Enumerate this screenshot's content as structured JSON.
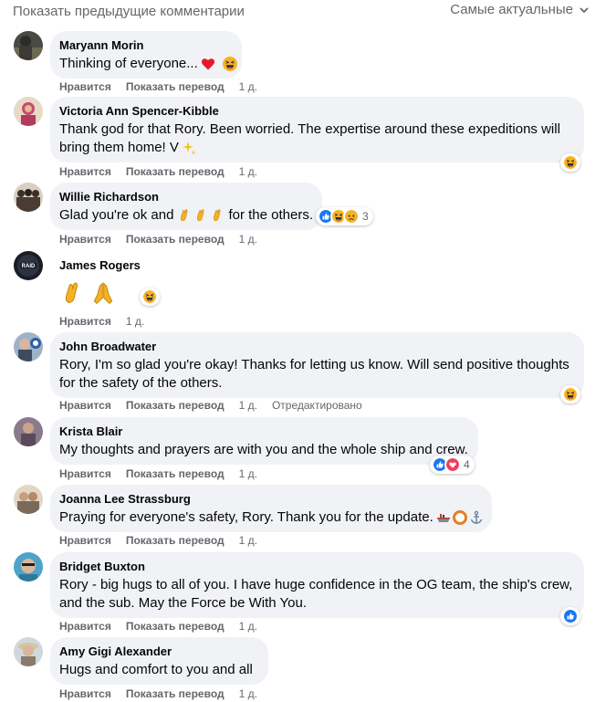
{
  "header": {
    "prev_comments": "Показать предыдущие комментарии",
    "sort_label": "Самые актуальные"
  },
  "actions": {
    "like": "Нравится",
    "translate": "Показать перевод",
    "edited": "Отредактировано"
  },
  "comments": [
    {
      "author": "Maryann Morin",
      "text": "Thinking of everyone...",
      "time": "1 д."
    },
    {
      "author": "Victoria Ann Spencer-Kibble",
      "text": "Thank god for that Rory. Been worried. The expertise around these expeditions will bring them home! V",
      "time": "1 д."
    },
    {
      "author": "Willie Richardson",
      "text": "Glad you're ok and",
      "text_after": "for the others.",
      "time": "1 д.",
      "reaction_count": "3"
    },
    {
      "author": "James Rogers",
      "text": "",
      "time": "1 д."
    },
    {
      "author": "John Broadwater",
      "text": "Rory, I'm so glad you're okay! Thanks for letting us know. Will send positive thoughts for the safety of the others.",
      "time": "1 д."
    },
    {
      "author": "Krista Blair",
      "text": "My thoughts and prayers are with you and the whole ship and crew.",
      "time": "1 д.",
      "reaction_count": "4"
    },
    {
      "author": "Joanna Lee Strassburg",
      "text": "Praying for everyone's safety, Rory. Thank you for the update.",
      "time": "1 д."
    },
    {
      "author": "Bridget Buxton",
      "text": "Rory - big hugs to all of you. I have huge confidence in the OG team, the ship's crew, and the sub. May the Force be With You.",
      "time": "1 д."
    },
    {
      "author": "Amy Gigi Alexander",
      "text": "Hugs and comfort to you and all",
      "time": "1 д."
    }
  ],
  "icons": {
    "heart": "red-heart-icon",
    "haha": "haha-reaction-icon",
    "like": "like-reaction-icon",
    "sad": "sad-reaction-icon",
    "love": "love-reaction-icon"
  },
  "colors": {
    "bubble": "#f0f2f5",
    "meta_text": "#65676b",
    "like_blue": "#1877f2",
    "love_red": "#f33e58",
    "haha_yellow": "#f7b125"
  }
}
